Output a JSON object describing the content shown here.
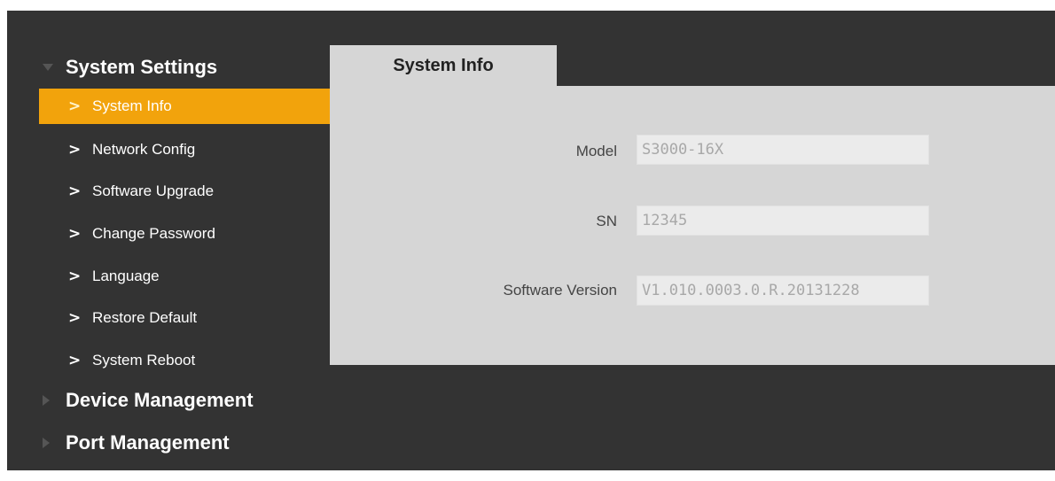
{
  "sidebar": {
    "groups": [
      {
        "label": "System Settings",
        "expanded": true,
        "icon": "triangle-down-icon",
        "items": [
          {
            "label": "System Info",
            "active": true,
            "icon": "chevron-right-icon"
          },
          {
            "label": "Network Config",
            "active": false,
            "icon": "chevron-right-icon"
          },
          {
            "label": "Software Upgrade",
            "active": false,
            "icon": "chevron-right-icon"
          },
          {
            "label": "Change Password",
            "active": false,
            "icon": "chevron-right-icon"
          },
          {
            "label": "Language",
            "active": false,
            "icon": "chevron-right-icon"
          },
          {
            "label": "Restore Default",
            "active": false,
            "icon": "chevron-right-icon"
          },
          {
            "label": "System Reboot",
            "active": false,
            "icon": "chevron-right-icon"
          }
        ]
      },
      {
        "label": "Device Management",
        "expanded": false,
        "icon": "triangle-right-icon"
      },
      {
        "label": "Port Management",
        "expanded": false,
        "icon": "triangle-right-icon"
      }
    ]
  },
  "main": {
    "tab": {
      "label": "System Info"
    },
    "fields": [
      {
        "label": "Model",
        "value": "S3000-16X"
      },
      {
        "label": "SN",
        "value": "12345"
      },
      {
        "label": "Software Version",
        "value": "V1.010.0003.0.R.20131228"
      }
    ]
  },
  "colors": {
    "background": "#333333",
    "accent": "#f2a30c",
    "panel": "#d6d6d6",
    "input_background": "#ebebeb",
    "input_text": "#a8a8a8"
  },
  "icons": {
    "nav_chevron": "›"
  }
}
